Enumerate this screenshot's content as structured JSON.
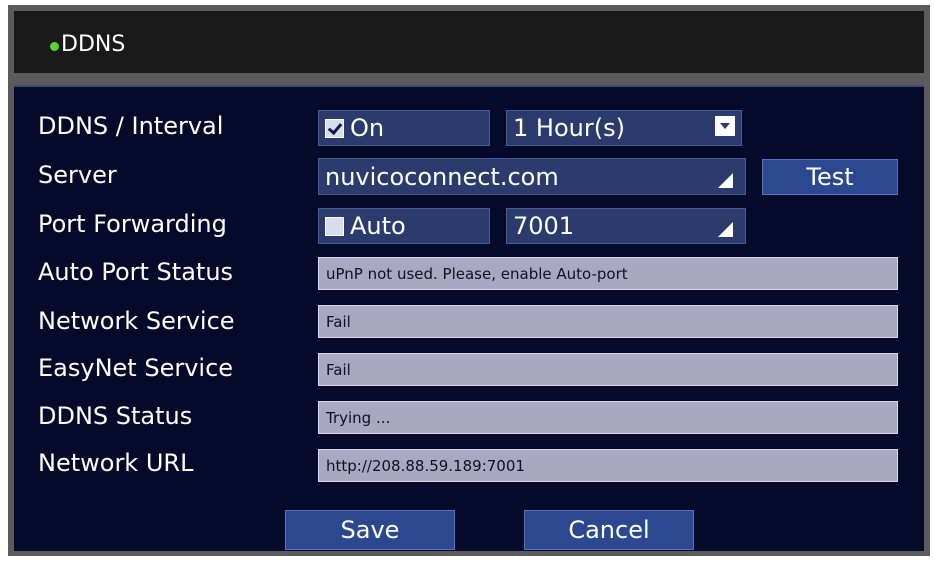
{
  "title": "DDNS",
  "rows": {
    "interval": {
      "label": "DDNS / Interval",
      "checkbox_label": "On",
      "checked": true,
      "interval_value": "1 Hour(s)"
    },
    "server": {
      "label": "Server",
      "value": "nuvicoconnect.com",
      "test_label": "Test"
    },
    "port_forwarding": {
      "label": "Port Forwarding",
      "checkbox_label": "Auto",
      "checked": false,
      "port_value": "7001"
    },
    "auto_port_status": {
      "label": "Auto Port Status",
      "value": "uPnP not used. Please, enable Auto-port"
    },
    "network_service": {
      "label": "Network Service",
      "value": "Fail"
    },
    "easynet_service": {
      "label": "EasyNet Service",
      "value": "Fail"
    },
    "ddns_status": {
      "label": "DDNS Status",
      "value": "Trying ..."
    },
    "network_url": {
      "label": "Network URL",
      "value": "http://208.88.59.189:7001"
    }
  },
  "buttons": {
    "save": "Save",
    "cancel": "Cancel"
  },
  "colors": {
    "panel_bg": "#050a2a",
    "field_bg": "#2b3b6e",
    "button_bg": "#2b4890",
    "status_bg": "#a8a8c2",
    "indicator": "#58d13a"
  }
}
